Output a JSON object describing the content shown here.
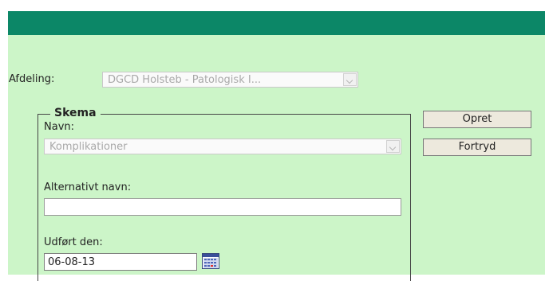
{
  "form": {
    "afdeling_label": "Afdeling:",
    "afdeling_value": "DGCD Holsteb - Patologisk I...",
    "skema_legend": "Skema",
    "navn_label": "Navn:",
    "navn_value": "Komplikationer",
    "alt_navn_label": "Alternativt navn:",
    "alt_navn_value": "",
    "udfoert_label": "Udført den:",
    "udfoert_value": "06-08-13"
  },
  "buttons": {
    "opret": "Opret",
    "fortryd": "Fortryd"
  },
  "colors": {
    "header": "#0c8767",
    "background": "#ccf5c8",
    "button": "#ede9dd"
  },
  "icons": {
    "calendar": "calendar-icon",
    "dropdown": "chevron-down-icon"
  }
}
